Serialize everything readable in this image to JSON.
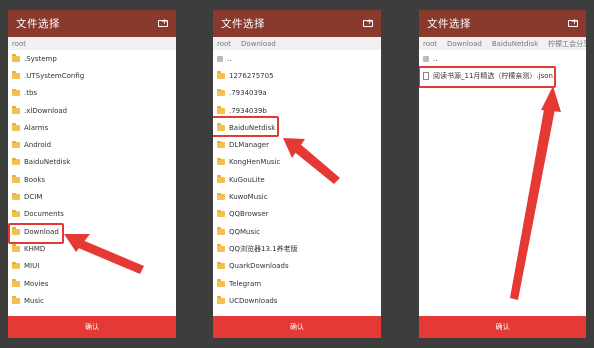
{
  "panels": [
    {
      "title": "文件选择",
      "breadcrumbs": [
        "root"
      ],
      "items": [
        {
          "label": ".Systemp",
          "type": "folder"
        },
        {
          "label": ".UTSystemConfig",
          "type": "folder"
        },
        {
          "label": ".tbs",
          "type": "folder"
        },
        {
          "label": ".xlDownload",
          "type": "folder"
        },
        {
          "label": "Alarms",
          "type": "folder"
        },
        {
          "label": "Android",
          "type": "folder"
        },
        {
          "label": "BaiduNetdisk",
          "type": "folder"
        },
        {
          "label": "Books",
          "type": "folder"
        },
        {
          "label": "DCIM",
          "type": "folder"
        },
        {
          "label": "Documents",
          "type": "folder"
        },
        {
          "label": "Download",
          "type": "folder",
          "highlighted": true
        },
        {
          "label": "KHMD",
          "type": "folder"
        },
        {
          "label": "MIUI",
          "type": "folder"
        },
        {
          "label": "Movies",
          "type": "folder"
        },
        {
          "label": "Music",
          "type": "folder"
        }
      ],
      "confirm_label": "确认"
    },
    {
      "title": "文件选择",
      "breadcrumbs": [
        "root",
        "Download"
      ],
      "items": [
        {
          "label": "..",
          "type": "up"
        },
        {
          "label": "1276275705",
          "type": "folder"
        },
        {
          "label": ".7934039a",
          "type": "folder"
        },
        {
          "label": ".7934039b",
          "type": "folder"
        },
        {
          "label": "BaiduNetdisk",
          "type": "folder",
          "highlighted": true
        },
        {
          "label": "DLManager",
          "type": "folder"
        },
        {
          "label": "KongHenMusic",
          "type": "folder"
        },
        {
          "label": "KuGouLite",
          "type": "folder"
        },
        {
          "label": "KuwoMusic",
          "type": "folder"
        },
        {
          "label": "QQBrowser",
          "type": "folder"
        },
        {
          "label": "QQMusic",
          "type": "folder"
        },
        {
          "label": "QQ浏览器13.1养老版",
          "type": "folder"
        },
        {
          "label": "QuarkDownloads",
          "type": "folder"
        },
        {
          "label": "Telegram",
          "type": "folder"
        },
        {
          "label": "UCDownloads",
          "type": "folder"
        }
      ],
      "confirm_label": "确认"
    },
    {
      "title": "文件选择",
      "breadcrumbs": [
        "root",
        "Download",
        "BaiduNetdisk",
        "柠檬工会分享"
      ],
      "items": [
        {
          "label": "..",
          "type": "up"
        },
        {
          "label": "阅读书源_11月精选（柠檬亲测）.json",
          "type": "file",
          "highlighted": true
        }
      ],
      "confirm_label": "确认"
    }
  ],
  "colors": {
    "titlebar": "#8a3a2d",
    "confirm": "#e53935",
    "highlight": "#e53935",
    "background": "#3d3d3d"
  }
}
